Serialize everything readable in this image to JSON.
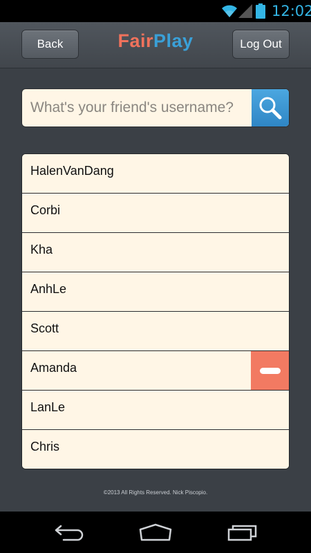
{
  "status_bar": {
    "time": "12:02",
    "icons": [
      "wifi-icon",
      "signal-icon",
      "battery-icon"
    ],
    "accent_color": "#33b5e5"
  },
  "header": {
    "back_label": "Back",
    "logout_label": "Log Out",
    "logo_part1": "Fair",
    "logo_part2": "Play",
    "logo_color1": "#f0725c",
    "logo_color2": "#3aa0d8"
  },
  "search": {
    "placeholder": "What's your friend's username?",
    "value": "",
    "icon": "search-icon"
  },
  "friends": [
    {
      "name": "HalenVanDang"
    },
    {
      "name": "Corbi"
    },
    {
      "name": "Kha"
    },
    {
      "name": "AnhLe"
    },
    {
      "name": "Scott"
    },
    {
      "name": "Amanda"
    },
    {
      "name": "LanLe"
    },
    {
      "name": "Chris"
    }
  ],
  "remove_icon": "minus-icon",
  "footer": {
    "copyright": "©2013 All Rights Reserved. Nick Piscopio."
  },
  "nav_bar": {
    "icons": [
      "back-nav-icon",
      "home-nav-icon",
      "recent-apps-icon"
    ]
  }
}
